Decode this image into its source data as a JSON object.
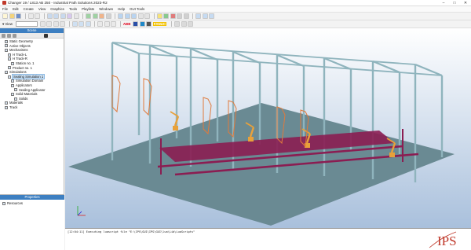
{
  "window": {
    "title": "Changer 19 / L813 AB 250 - Industrial Path Solutions 2023-R2",
    "controls": [
      "–",
      "□",
      "✕"
    ]
  },
  "menu": [
    "File",
    "Edit",
    "Create",
    "View",
    "Graphics",
    "Tools",
    "Playlists",
    "Windows",
    "Help",
    "GUI Tools"
  ],
  "toolbar": {
    "view_label": "▾ View",
    "brand_labels": [
      "ABB",
      "FANUC"
    ]
  },
  "sidebar": {
    "title": "Scene",
    "tree": [
      {
        "label": "Static Geometry",
        "level": 1,
        "icon": "folder-icon"
      },
      {
        "label": "Active Objects",
        "level": 1,
        "icon": "folder-icon"
      },
      {
        "label": "Mechanisms",
        "level": 1,
        "icon": "folder-icon"
      },
      {
        "label": "H Track-L",
        "level": 2,
        "icon": "robot-icon"
      },
      {
        "label": "H Track-R",
        "level": 2,
        "icon": "robot-icon"
      },
      {
        "label": "Station no. 1",
        "level": 3,
        "icon": "station-icon"
      },
      {
        "label": "Product no. 1",
        "level": 2,
        "icon": "product-icon"
      },
      {
        "label": "Simulations",
        "level": 1,
        "icon": "folder-icon"
      },
      {
        "label": "Sealing Simulation 1",
        "level": 2,
        "icon": "simulation-icon"
      },
      {
        "label": "Simulation Domain",
        "level": 3,
        "icon": "domain-icon"
      },
      {
        "label": "Applicators",
        "level": 3,
        "icon": "applicator-icon"
      },
      {
        "label": "Sealing Applicator",
        "level": 4,
        "icon": "applicator-icon"
      },
      {
        "label": "Solid Materials",
        "level": 3,
        "icon": "material-icon"
      },
      {
        "label": "Solids",
        "level": 4,
        "icon": "solid-icon"
      },
      {
        "label": "Materials",
        "level": 1,
        "icon": "folder-icon"
      },
      {
        "label": "Track",
        "level": 1,
        "icon": "folder-icon"
      }
    ],
    "selected_index": 8
  },
  "properties": {
    "title": "Properties",
    "items": [
      "Resources"
    ]
  },
  "console": {
    "lines": [
      "[12:04:11] Executing luascript file \"E:\\IPS\\GUI\\IPS\\GUI\\lua\\Lib\\LuaScripts\""
    ]
  },
  "logo": {
    "text": "IPS",
    "color": "#c0392b"
  },
  "colors": {
    "panel_header": "#3d7fc1",
    "viewport_top": "#ffffff",
    "viewport_bottom": "#a9c0dc",
    "floor": "#6a8a93",
    "frame": "#8fb4bd",
    "conveyor": "#8b1d52",
    "robot": "#e8a13a",
    "path": "#e07a3c"
  }
}
